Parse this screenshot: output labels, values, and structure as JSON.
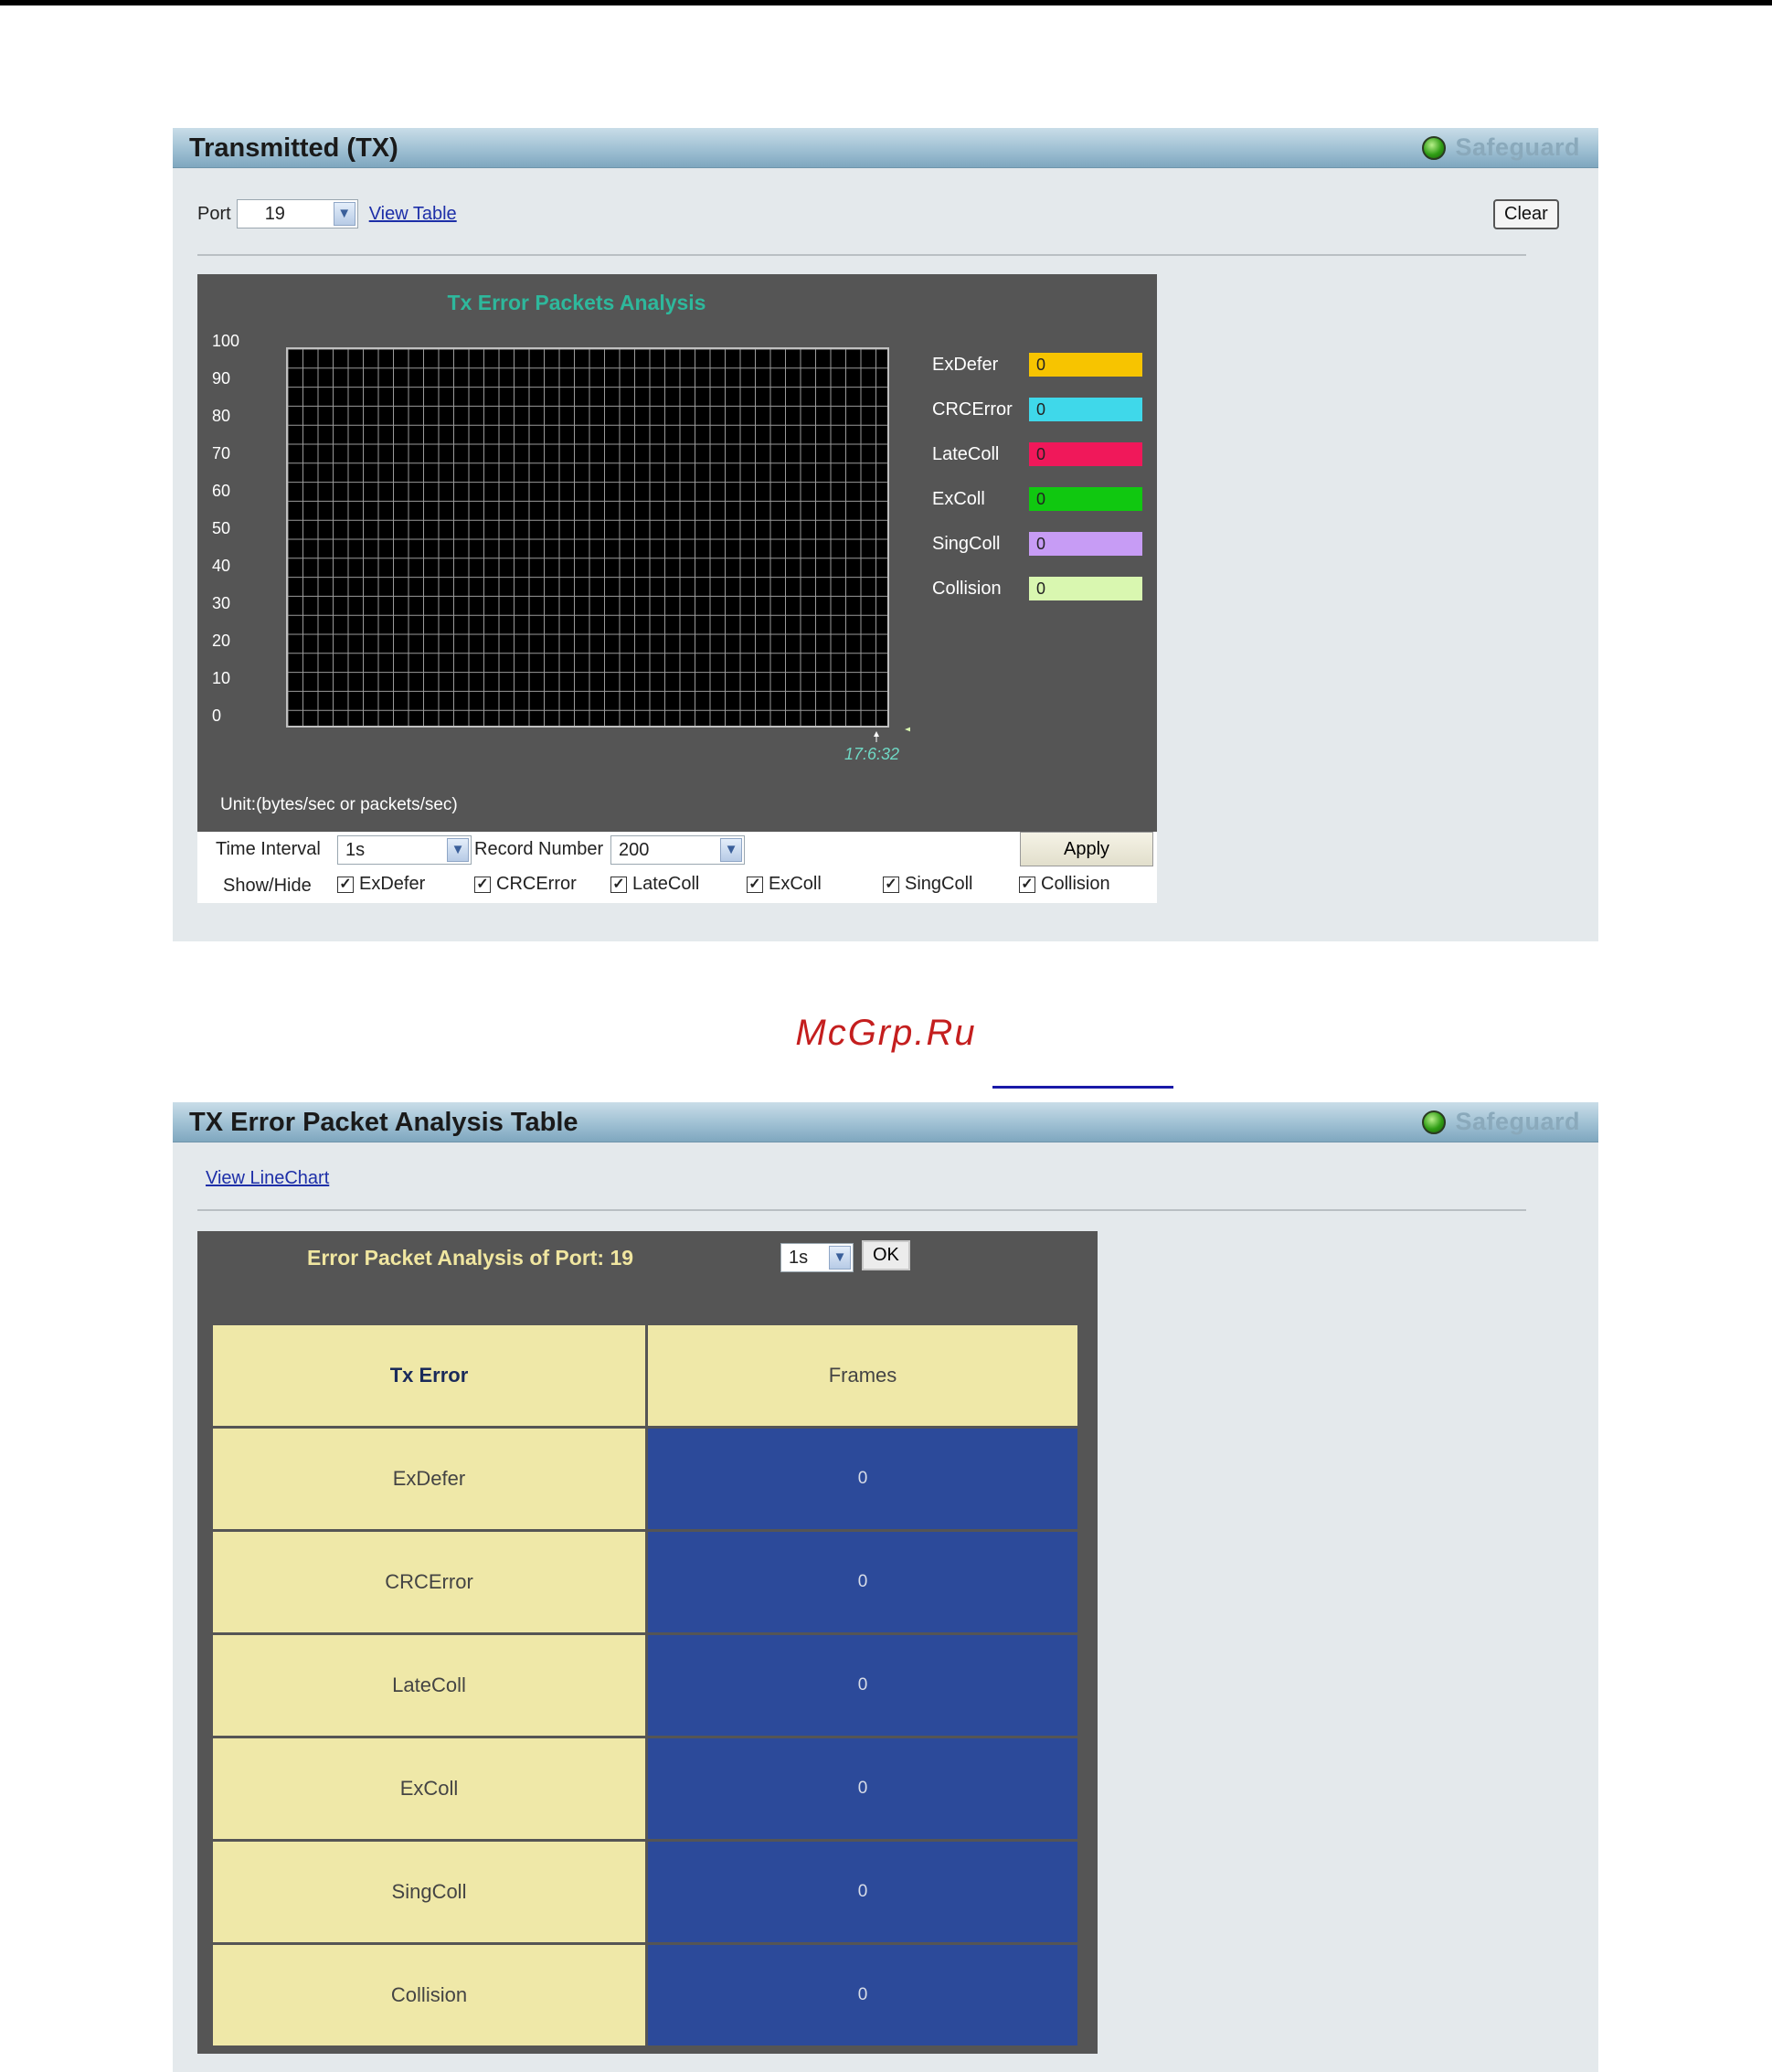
{
  "tx_panel": {
    "title": "Transmitted (TX)",
    "safeguard": "Safeguard",
    "port_label": "Port",
    "port_value": "19",
    "view_table_link": "View Table",
    "clear_button": "Clear"
  },
  "chart_data": {
    "type": "line",
    "title": "Tx Error Packets Analysis",
    "ylim": [
      0,
      100
    ],
    "y_ticks": [
      "100",
      "90",
      "80",
      "70",
      "60",
      "50",
      "40",
      "30",
      "20",
      "10",
      "0"
    ],
    "x_ticks": [
      "17:6:32"
    ],
    "unit_label": "Unit:(bytes/sec or packets/sec)",
    "grid": true,
    "legend_position": "right",
    "series": [
      {
        "name": "ExDefer",
        "value": "0",
        "color": "#f7c400"
      },
      {
        "name": "CRCError",
        "value": "0",
        "color": "#3fd8ea"
      },
      {
        "name": "LateColl",
        "value": "0",
        "color": "#f0185a"
      },
      {
        "name": "ExColl",
        "value": "0",
        "color": "#10c810"
      },
      {
        "name": "SingColl",
        "value": "0",
        "color": "#c79cf5"
      },
      {
        "name": "Collision",
        "value": "0",
        "color": "#d9f7b0"
      }
    ]
  },
  "controls": {
    "time_interval_label": "Time Interval",
    "time_interval_value": "1s",
    "record_number_label": "Record Number",
    "record_number_value": "200",
    "apply_button": "Apply",
    "show_hide_label": "Show/Hide",
    "checkboxes": [
      "ExDefer",
      "CRCError",
      "LateColl",
      "ExColl",
      "SingColl",
      "Collision"
    ]
  },
  "watermark": "McGrp.Ru",
  "table_panel": {
    "title": "TX Error Packet Analysis Table",
    "safeguard": "Safeguard",
    "view_linechart_link": "View LineChart",
    "analysis_title": "Error Packet Analysis of Port: 19",
    "interval_value": "1s",
    "ok_button": "OK",
    "col_headers": [
      "Tx Error",
      "Frames"
    ],
    "rows": [
      {
        "name": "ExDefer",
        "frames": "0"
      },
      {
        "name": "CRCError",
        "frames": "0"
      },
      {
        "name": "LateColl",
        "frames": "0"
      },
      {
        "name": "ExColl",
        "frames": "0"
      },
      {
        "name": "SingColl",
        "frames": "0"
      },
      {
        "name": "Collision",
        "frames": "0"
      }
    ]
  }
}
